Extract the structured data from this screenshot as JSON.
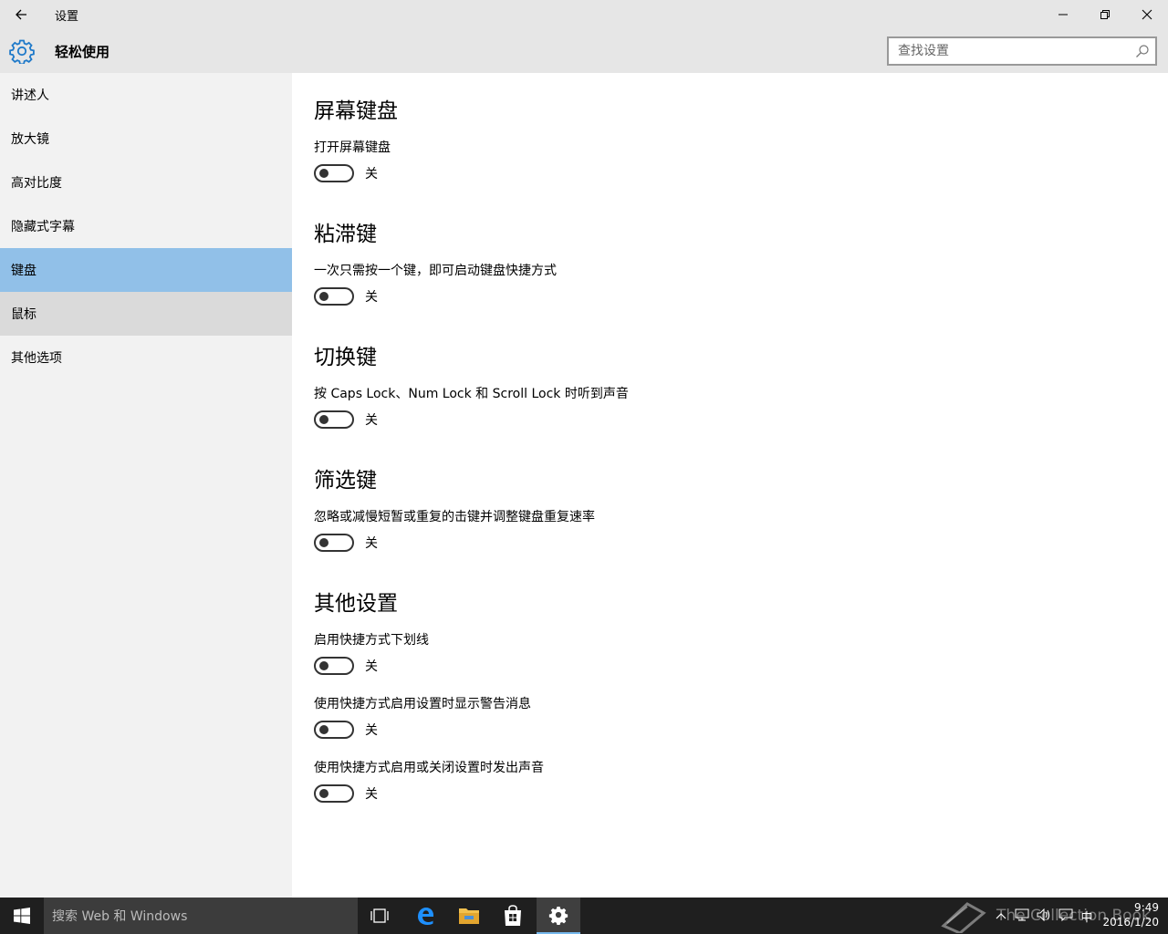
{
  "window": {
    "title": "设置"
  },
  "header": {
    "title": "轻松使用",
    "search_placeholder": "查找设置"
  },
  "sidebar": {
    "items": [
      {
        "label": "讲述人"
      },
      {
        "label": "放大镜"
      },
      {
        "label": "高对比度"
      },
      {
        "label": "隐藏式字幕"
      },
      {
        "label": "键盘"
      },
      {
        "label": "鼠标"
      },
      {
        "label": "其他选项"
      }
    ],
    "selected": "键盘"
  },
  "content": {
    "sections": [
      {
        "title": "屏幕键盘",
        "settings": [
          {
            "label": "打开屏幕键盘",
            "state": "关"
          }
        ]
      },
      {
        "title": "粘滞键",
        "settings": [
          {
            "label": "一次只需按一个键，即可启动键盘快捷方式",
            "state": "关"
          }
        ]
      },
      {
        "title": "切换键",
        "settings": [
          {
            "label": "按 Caps Lock、Num Lock 和 Scroll Lock 时听到声音",
            "state": "关"
          }
        ]
      },
      {
        "title": "筛选键",
        "settings": [
          {
            "label": "忽略或减慢短暂或重复的击键并调整键盘重复速率",
            "state": "关"
          }
        ]
      },
      {
        "title": "其他设置",
        "settings": [
          {
            "label": "启用快捷方式下划线",
            "state": "关"
          },
          {
            "label": "使用快捷方式启用设置时显示警告消息",
            "state": "关"
          },
          {
            "label": "使用快捷方式启用或关闭设置时发出声音",
            "state": "关"
          }
        ]
      }
    ]
  },
  "taskbar": {
    "search_placeholder": "搜索 Web 和 Windows",
    "ime": "中",
    "time": "9:49",
    "date": "2016/1/20",
    "watermark": "The Collection Book"
  },
  "colors": {
    "accent": "#1e79c9",
    "selected_bg": "#91c0e8",
    "chrome_bg": "#e6e6e6",
    "sidebar_bg": "#f2f2f2"
  }
}
